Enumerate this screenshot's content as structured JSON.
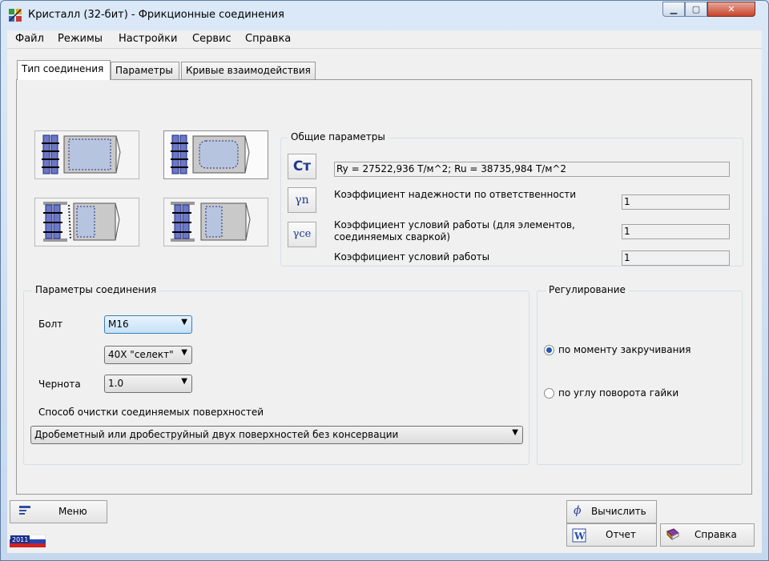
{
  "window": {
    "title": "Кристалл (32-бит) - Фрикционные соединения",
    "controls": {
      "minimize": "▁",
      "maximize": "▢",
      "close": "✕"
    }
  },
  "menu": [
    "Файл",
    "Режимы",
    "Настройки",
    "Сервис",
    "Справка"
  ],
  "tabs": [
    {
      "label": "Тип соединения",
      "active": true
    },
    {
      "label": "Параметры",
      "active": false
    },
    {
      "label": "Кривые взаимодействия",
      "active": false
    }
  ],
  "general_params": {
    "title": "Общие параметры",
    "steel_button": "Ст",
    "gamma_n_button": "γn",
    "gamma_ce_button": "γce",
    "steel_value": "Ry = 27522,936 Т/м^2; Ru = 38735,984 Т/м^2",
    "rows": [
      {
        "label": "Коэффициент надежности по ответственности",
        "value": "1"
      },
      {
        "label": "Коэффициент условий работы (для элементов,\nсоединяемых сваркой)",
        "value": "1"
      },
      {
        "label": "Коэффициент условий работы",
        "value": "1"
      }
    ]
  },
  "connection_params": {
    "title": "Параметры соединения",
    "bolt_label": "Болт",
    "bolt_value": "M16",
    "steel_value": "40Х \"селект\"",
    "roughness_label": "Чернота",
    "roughness_value": "1.0",
    "cleaning_label": "Способ очистки соединяемых поверхностей",
    "cleaning_value": "Дробеметный или дробеструйный двух поверхностей без консервации"
  },
  "regulation": {
    "title": "Регулирование",
    "options": [
      {
        "label": "по моменту закручивания",
        "checked": true
      },
      {
        "label": "по углу поворота гайки",
        "checked": false
      }
    ]
  },
  "buttons": {
    "menu": "Меню",
    "calculate": "Вычислить",
    "report": "Отчет",
    "help": "Справка"
  },
  "badge": "2011",
  "colors": {
    "accent_blue": "#1f3a8a",
    "close_red": "#c7442a",
    "window_frame": "#cfe0f3"
  }
}
